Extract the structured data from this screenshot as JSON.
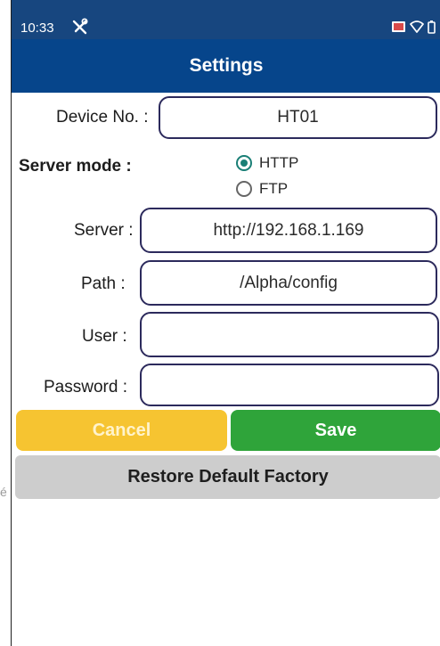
{
  "status_bar": {
    "time": "10:33",
    "icons": [
      "tools-icon",
      "cast-icon",
      "wifi-icon",
      "battery-icon"
    ]
  },
  "header": {
    "title": "Settings"
  },
  "form": {
    "device_no": {
      "label": "Device No. :",
      "value": "HT01"
    },
    "server_mode": {
      "label": "Server mode :",
      "options": [
        {
          "label": "HTTP",
          "selected": true
        },
        {
          "label": "FTP",
          "selected": false
        }
      ]
    },
    "server": {
      "label": "Server :",
      "value": "http://192.168.1.169"
    },
    "path": {
      "label": "Path :",
      "value": "/Alpha/config"
    },
    "user": {
      "label": "User :",
      "value": ""
    },
    "password": {
      "label": "Password :",
      "value": ""
    }
  },
  "actions": {
    "cancel_label": "Cancel",
    "save_label": "Save",
    "restore_label": "Restore Default Factory"
  },
  "colors": {
    "header_bg": "#06458b",
    "cancel_bg": "#f6c431",
    "save_bg": "#2fa43a",
    "restore_bg": "#cdcdcd",
    "field_border": "#2c2a5c",
    "radio_accent": "#1a7f76"
  }
}
